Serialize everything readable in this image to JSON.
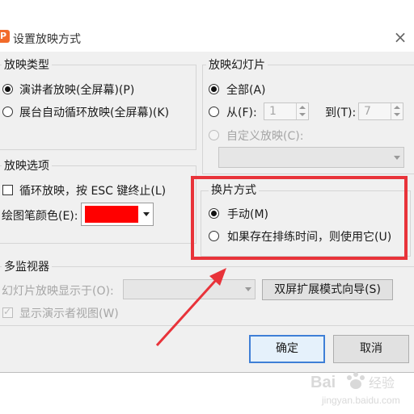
{
  "window": {
    "app_icon": "P",
    "title": "设置放映方式",
    "close_glyph": "×"
  },
  "show_type": {
    "label": "放映类型",
    "options": [
      {
        "label": "演讲者放映(全屏幕)(P)",
        "checked": true
      },
      {
        "label": "展台自动循环放映(全屏幕)(K)",
        "checked": false
      }
    ]
  },
  "slides": {
    "label": "放映幻灯片",
    "all_label": "全部(A)",
    "from_label": "从(F):",
    "from_value": "1",
    "to_label": "到(T):",
    "to_value": "7",
    "custom_label": "自定义放映(C):"
  },
  "show_options": {
    "label": "放映选项",
    "loop_label": "循环放映，按 ESC 键终止(L)",
    "pen_color_label": "绘图笔颜色(E):",
    "pen_color": "#ff0000"
  },
  "advance": {
    "label": "换片方式",
    "manual_label": "手动(M)",
    "timings_label": "如果存在排练时间，则使用它(U)"
  },
  "monitors": {
    "label": "多监视器",
    "display_on_label": "幻灯片放映显示于(O):",
    "dual_screen_button": "双屏扩展模式向导(S)",
    "presenter_view_label": "显示演示者视图(W)"
  },
  "buttons": {
    "ok": "确定",
    "cancel": "取消"
  },
  "watermark": {
    "text": "Bai 经验",
    "url": "jingyan.baidu.com"
  },
  "colors": {
    "highlight": "#e8333a",
    "primary_border": "#3f7fd6",
    "app_icon": "#f26b2a"
  }
}
